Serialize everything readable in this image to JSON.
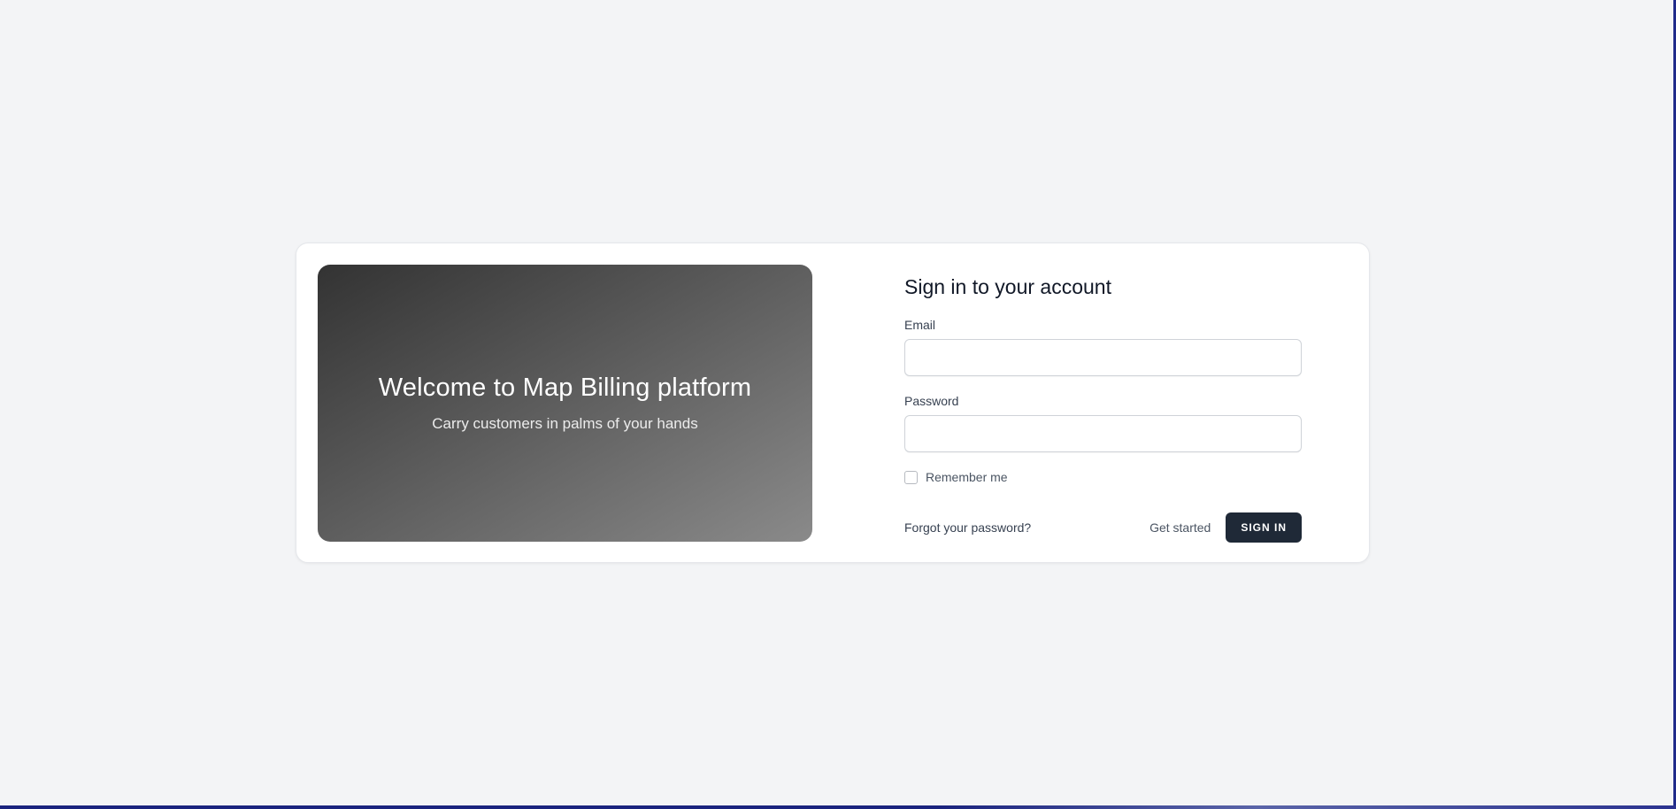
{
  "hero": {
    "title": "Welcome to Map Billing platform",
    "subtitle": "Carry customers in palms of your hands"
  },
  "form": {
    "title": "Sign in to your account",
    "email": {
      "label": "Email",
      "value": "",
      "placeholder": ""
    },
    "password": {
      "label": "Password",
      "value": "",
      "placeholder": ""
    },
    "remember": {
      "label": "Remember me",
      "checked": false
    },
    "forgot_label": "Forgot your password?",
    "get_started_label": "Get started",
    "signin_label": "SIGN IN"
  },
  "colors": {
    "page_background": "#f3f4f6",
    "primary_button": "#1f2937",
    "hero_gradient_start": "#333333",
    "hero_gradient_end": "#8a8a8a"
  }
}
